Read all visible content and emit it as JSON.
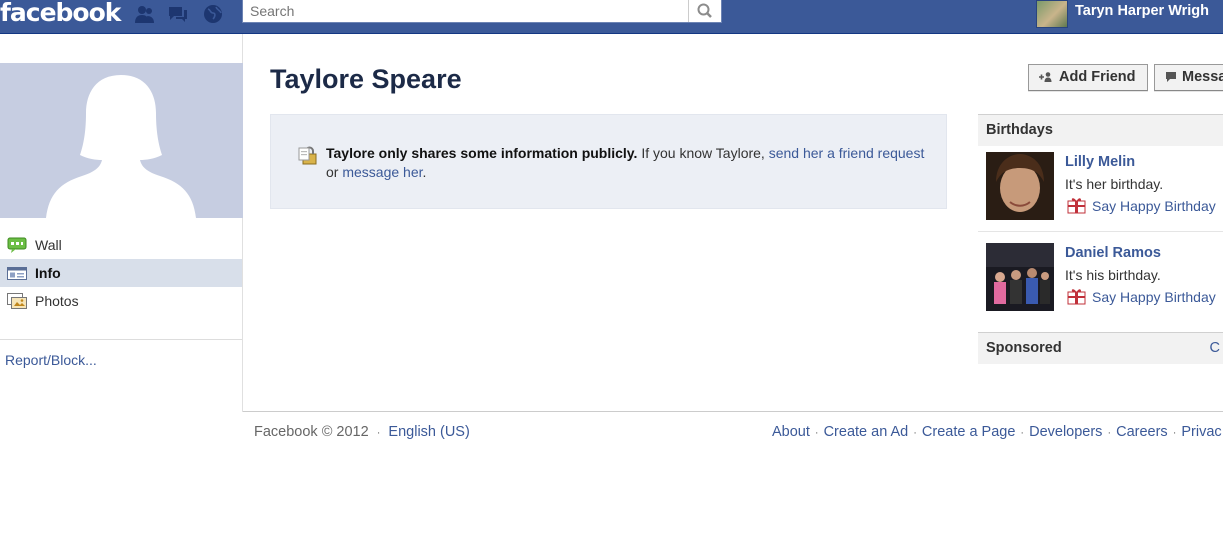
{
  "header": {
    "logo": "facebook",
    "search_placeholder": "Search",
    "user_name": "Taryn Harper Wrigh"
  },
  "sidebar": {
    "nav": [
      {
        "label": "Wall",
        "icon": "wall-icon"
      },
      {
        "label": "Info",
        "icon": "info-icon"
      },
      {
        "label": "Photos",
        "icon": "photos-icon"
      }
    ],
    "report_label": "Report/Block..."
  },
  "profile": {
    "name": "Taylore Speare",
    "notice": {
      "bold": "Taylore only shares some information publicly.",
      "pre": " If you know Taylore, ",
      "link1": "send her a friend request",
      "mid": " or ",
      "link2": "message her",
      "end": "."
    }
  },
  "actions": {
    "add_friend": "Add Friend",
    "message": "Messa"
  },
  "birthdays": {
    "heading": "Birthdays",
    "people": [
      {
        "name": "Lilly Melin",
        "note": "It's her birthday.",
        "action": "Say Happy Birthday"
      },
      {
        "name": "Daniel Ramos",
        "note": "It's his birthday.",
        "action": "Say Happy Birthday"
      }
    ]
  },
  "sponsored": {
    "heading": "Sponsored",
    "more": "C"
  },
  "footer": {
    "copyright": "Facebook © 2012",
    "language": "English (US)",
    "links": [
      "About",
      "Create an Ad",
      "Create a Page",
      "Developers",
      "Careers",
      "Privac"
    ]
  },
  "colors": {
    "brand_blue": "#3b5998",
    "nav_active_bg": "#d8dfea",
    "notice_bg": "#eceff5"
  }
}
